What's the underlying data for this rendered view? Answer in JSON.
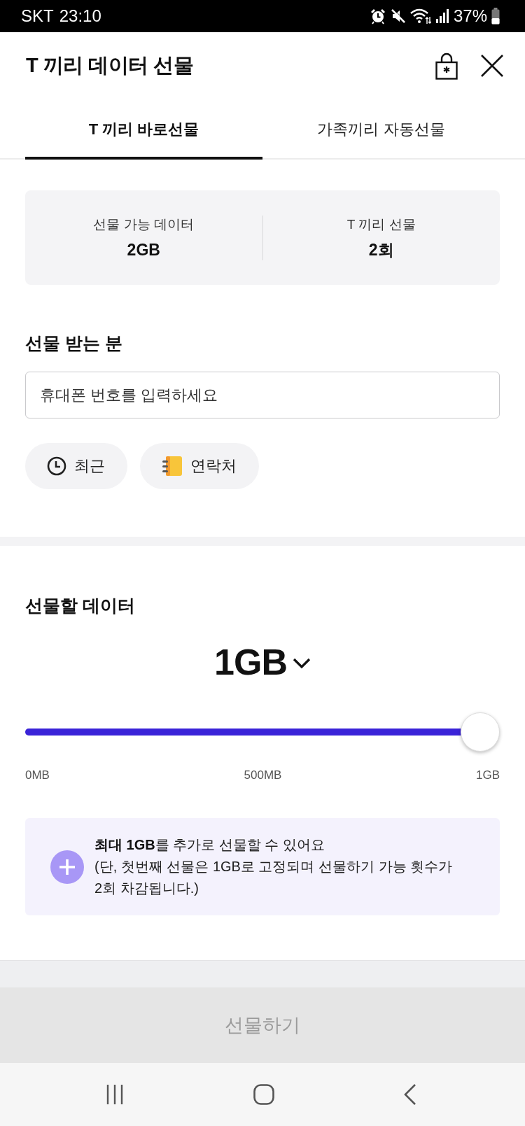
{
  "status_bar": {
    "carrier": "SKT",
    "time": "23:10",
    "battery": "37%"
  },
  "header": {
    "title": "T 끼리 데이터 선물"
  },
  "tabs": [
    {
      "label": "T 끼리 바로선물",
      "selected": true
    },
    {
      "label": "가족끼리 자동선물",
      "selected": false
    }
  ],
  "summary": [
    {
      "label": "선물 가능 데이터",
      "value": "2GB"
    },
    {
      "label": "T 끼리 선물",
      "value": "2회"
    }
  ],
  "recipient": {
    "heading": "선물 받는 분",
    "placeholder": "휴대폰 번호를 입력하세요",
    "shortcuts": [
      {
        "kind": "recent",
        "label": "최근"
      },
      {
        "kind": "contacts",
        "label": "연락처"
      }
    ]
  },
  "amount": {
    "heading": "선물할 데이터",
    "value": "1GB",
    "level": 1,
    "ticks": [
      "0MB",
      "500MB",
      "1GB"
    ]
  },
  "notice": {
    "title": "**최대 1GB**를 추가로 선물할 수 있어요",
    "detail": "(단, 첫번째 선물은 1GB로 고정되며 선물하기 가능 횟수가 2회 차감됩니다.)"
  },
  "submit": {
    "label": "선물하기",
    "disabled": true
  }
}
